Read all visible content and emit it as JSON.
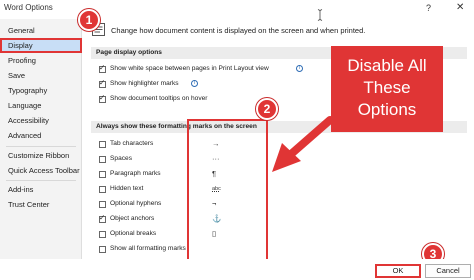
{
  "window": {
    "title": "Word Options",
    "help_glyph": "?",
    "close_glyph": "✕"
  },
  "sidebar": {
    "items": [
      {
        "label": "General"
      },
      {
        "label": "Display"
      },
      {
        "label": "Proofing"
      },
      {
        "label": "Save"
      },
      {
        "label": "Typography"
      },
      {
        "label": "Language"
      },
      {
        "label": "Accessibility"
      },
      {
        "label": "Advanced"
      },
      {
        "label": "Customize Ribbon"
      },
      {
        "label": "Quick Access Toolbar"
      },
      {
        "label": "Add-ins"
      },
      {
        "label": "Trust Center"
      }
    ],
    "selected": "Display"
  },
  "main": {
    "header_text": "Change how document content is displayed on the screen and when printed.",
    "page_display": {
      "heading": "Page display options",
      "options": [
        {
          "label": "Show white space between pages in Print Layout view",
          "checked": true,
          "has_info": true
        },
        {
          "label": "Show highlighter marks",
          "checked": true,
          "has_info": true
        },
        {
          "label": "Show document tooltips on hover",
          "checked": true,
          "has_info": false
        }
      ]
    },
    "formatting_marks": {
      "heading": "Always show these formatting marks on the screen",
      "options": [
        {
          "label": "Tab characters",
          "symbol": "→",
          "checked": false
        },
        {
          "label": "Spaces",
          "symbol": "···",
          "checked": false
        },
        {
          "label": "Paragraph marks",
          "symbol": "¶",
          "checked": false
        },
        {
          "label": "Hidden text",
          "symbol": "abc",
          "checked": false
        },
        {
          "label": "Optional hyphens",
          "symbol": "¬",
          "checked": false
        },
        {
          "label": "Object anchors",
          "symbol": "⚓",
          "checked": true
        },
        {
          "label": "Optional breaks",
          "symbol": "▯",
          "checked": false
        },
        {
          "label": "Show all formatting marks",
          "symbol": "",
          "checked": false
        }
      ]
    }
  },
  "callout": {
    "text_line1": "Disable All",
    "text_line2": "These",
    "text_line3": "Options"
  },
  "badges": [
    "1",
    "2",
    "3"
  ],
  "footer": {
    "ok_label": "OK",
    "cancel_label": "Cancel"
  },
  "colors": {
    "accent_red": "#e03535",
    "selected_bg": "#c8def6",
    "info_blue": "#2f6db5"
  }
}
